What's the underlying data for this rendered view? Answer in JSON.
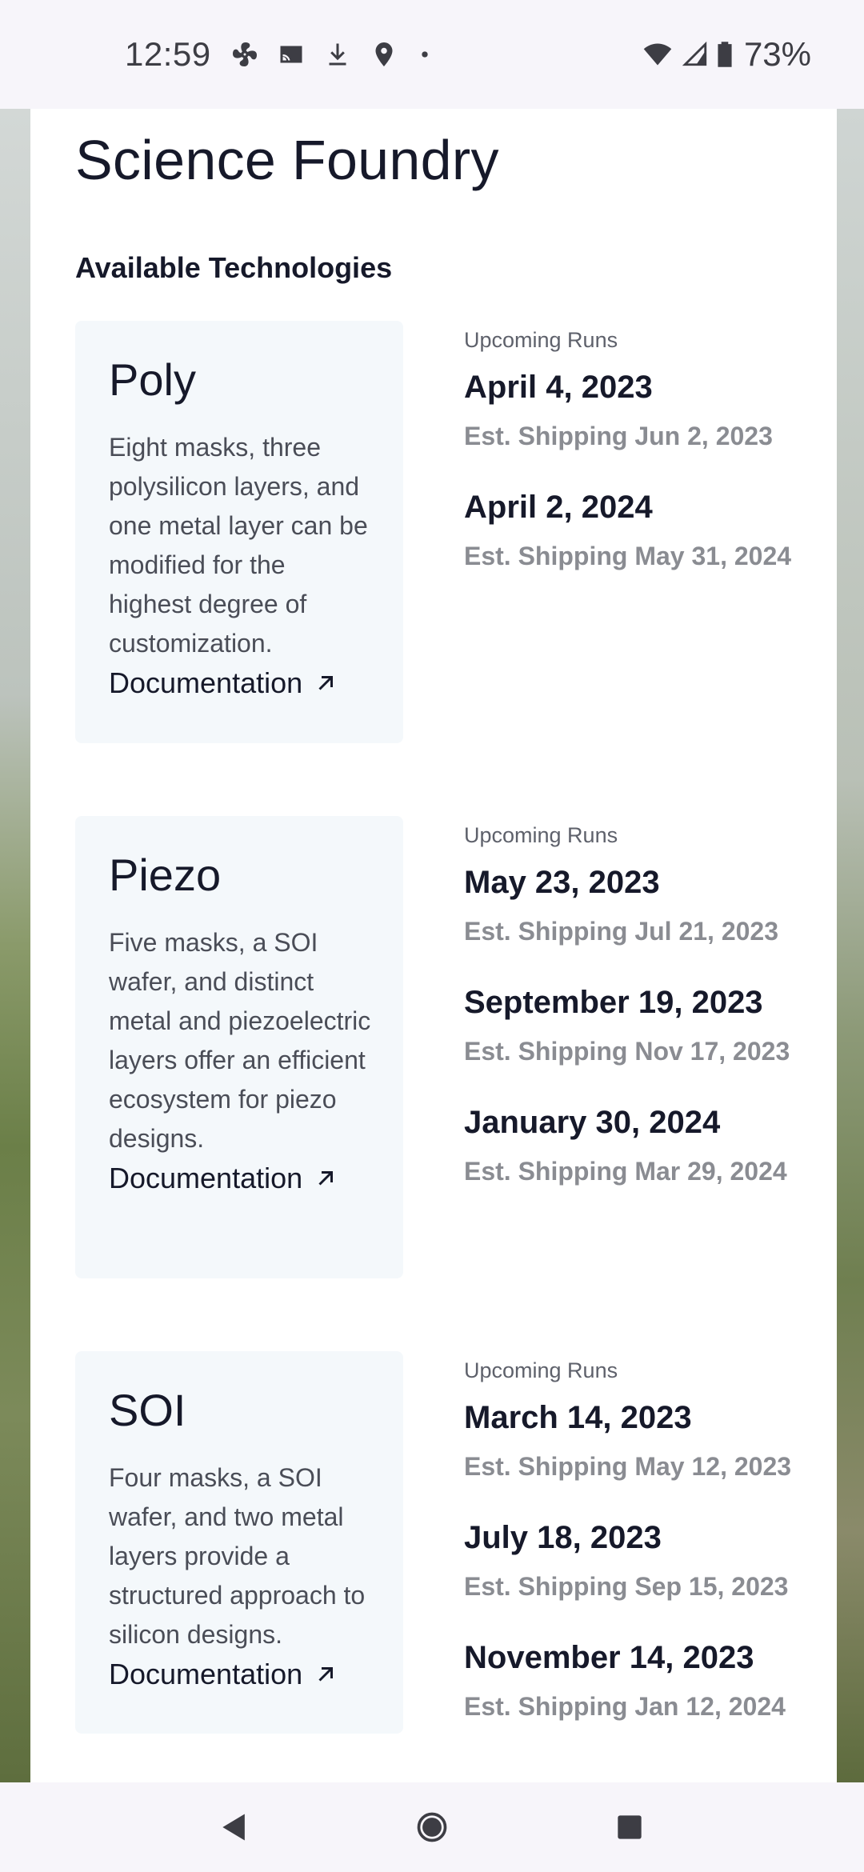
{
  "status_bar": {
    "time": "12:59",
    "battery": "73%",
    "left_icons": [
      "fan-icon",
      "cast-icon",
      "download-icon",
      "location-icon",
      "dot-icon"
    ],
    "right_icons": [
      "wifi-icon",
      "signal-icon",
      "battery-icon"
    ]
  },
  "page": {
    "title": "Science Foundry",
    "section_heading": "Available Technologies"
  },
  "technologies": [
    {
      "name": "Poly",
      "description": "Eight masks, three polysilicon layers, and one metal layer can be modified for the highest degree of customization.",
      "doc_label": "Documentation",
      "runs_label": "Upcoming Runs",
      "runs": [
        {
          "date": "April 4, 2023",
          "shipping": "Est. Shipping Jun 2, 2023"
        },
        {
          "date": "April 2, 2024",
          "shipping": "Est. Shipping May 31, 2024"
        }
      ]
    },
    {
      "name": "Piezo",
      "description": "Five masks, a SOI wafer, and distinct metal and piezoelectric layers offer an efficient ecosystem for piezo designs.",
      "doc_label": "Documentation",
      "runs_label": "Upcoming Runs",
      "runs": [
        {
          "date": "May 23, 2023",
          "shipping": "Est. Shipping Jul 21, 2023"
        },
        {
          "date": "September 19, 2023",
          "shipping": "Est. Shipping Nov 17, 2023"
        },
        {
          "date": "January 30, 2024",
          "shipping": "Est. Shipping Mar 29, 2024"
        }
      ]
    },
    {
      "name": "SOI",
      "description": "Four masks, a SOI wafer, and two metal layers provide a structured approach to silicon designs.",
      "doc_label": "Documentation",
      "runs_label": "Upcoming Runs",
      "runs": [
        {
          "date": "March 14, 2023",
          "shipping": "Est. Shipping May 12, 2023"
        },
        {
          "date": "July 18, 2023",
          "shipping": "Est. Shipping Sep 15, 2023"
        },
        {
          "date": "November 14, 2023",
          "shipping": "Est. Shipping Jan 12, 2024"
        }
      ]
    }
  ],
  "nav_bar": {
    "buttons": [
      "back-icon",
      "home-icon",
      "recents-icon"
    ]
  },
  "colors": {
    "title_text": "#16192a",
    "card_bg": "#f4f8fb",
    "muted_text": "#8a8c92"
  }
}
